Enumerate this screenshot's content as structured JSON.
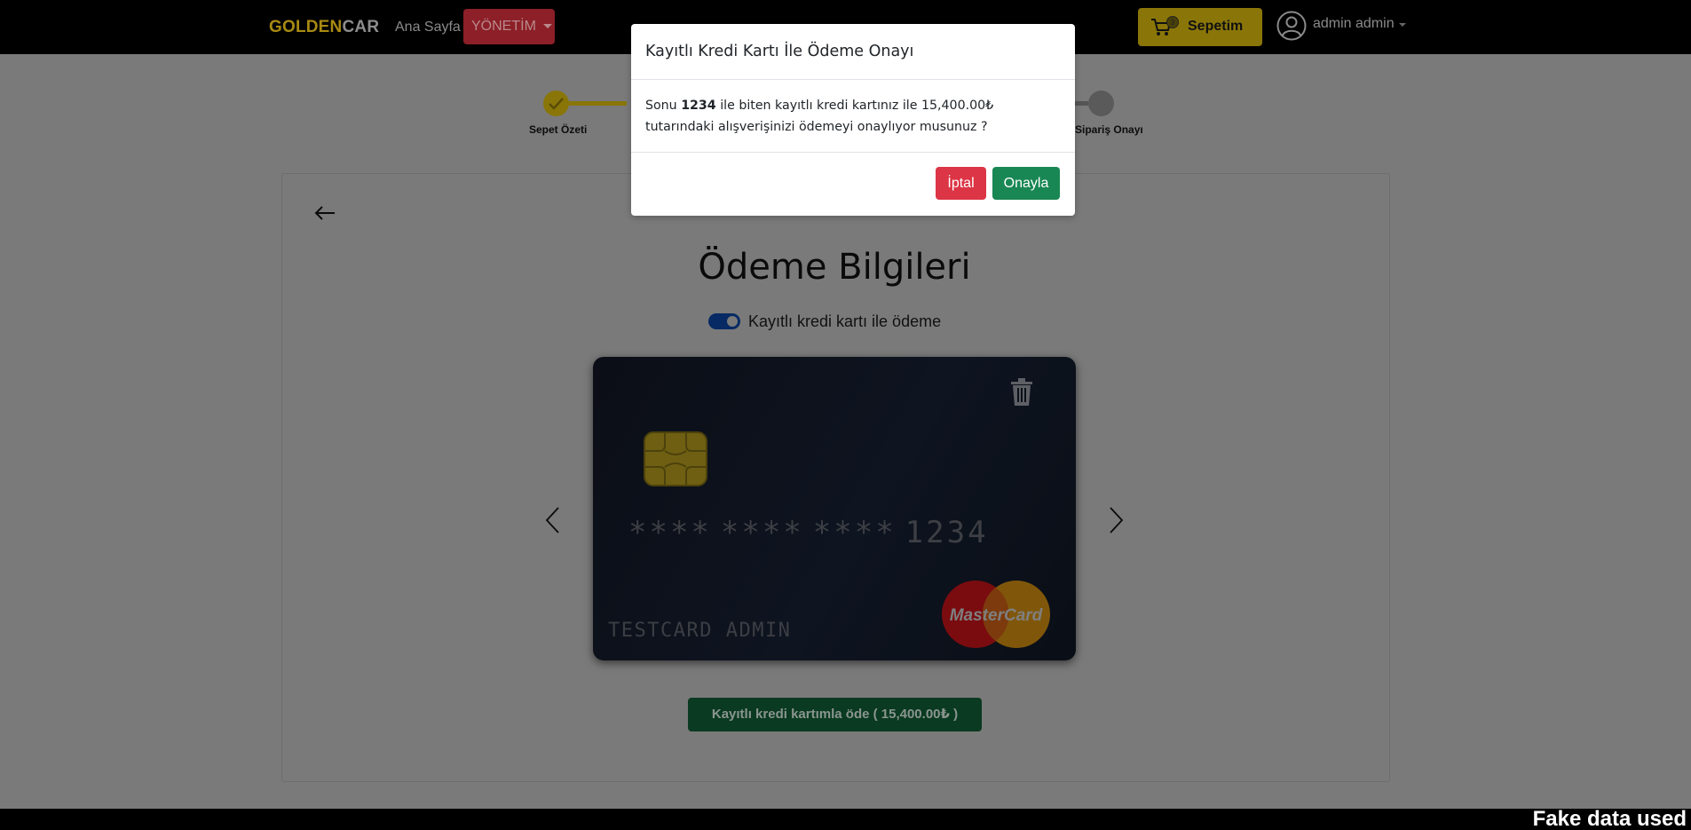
{
  "navbar": {
    "brand_gold": "GOLDEN",
    "brand_rest": "CAR",
    "home_label": "Ana Sayfa",
    "admin_label": "YÖNETİM",
    "cart_label": "Sepetim",
    "cart_count": "3",
    "user_name": "admin admin"
  },
  "steps": [
    {
      "label": "Sepet Özeti",
      "done": true
    },
    {
      "label": "Sipariş Onayı",
      "done": false
    }
  ],
  "payment": {
    "title": "Ödeme Bilgileri",
    "toggle_label": "Kayıtlı kredi kartı ile ödeme",
    "toggle_on": true,
    "pay_button": "Kayıtlı kredi kartımla öde ( 15,400.00₺ )"
  },
  "card": {
    "number_groups": [
      "****",
      "****",
      "****",
      "1234"
    ],
    "holder": "TESTCARD ADMIN",
    "brand": "MasterCard"
  },
  "modal": {
    "title": "Kayıtlı Kredi Kartı İle Ödeme Onayı",
    "body_prefix": "Sonu ",
    "body_last4": "1234",
    "body_suffix": " ile biten kayıtlı kredi kartınız ile 15,400.00₺ tutarındaki alışverişinizi ödemeyi onaylıyor musunuz ?",
    "cancel_label": "İptal",
    "confirm_label": "Onayla"
  },
  "watermark": "Fake data used",
  "colors": {
    "brand_gold": "#ffc107",
    "cancel": "#dc3545",
    "confirm": "#198754",
    "backdrop": "rgba(0,0,0,0.5)"
  }
}
